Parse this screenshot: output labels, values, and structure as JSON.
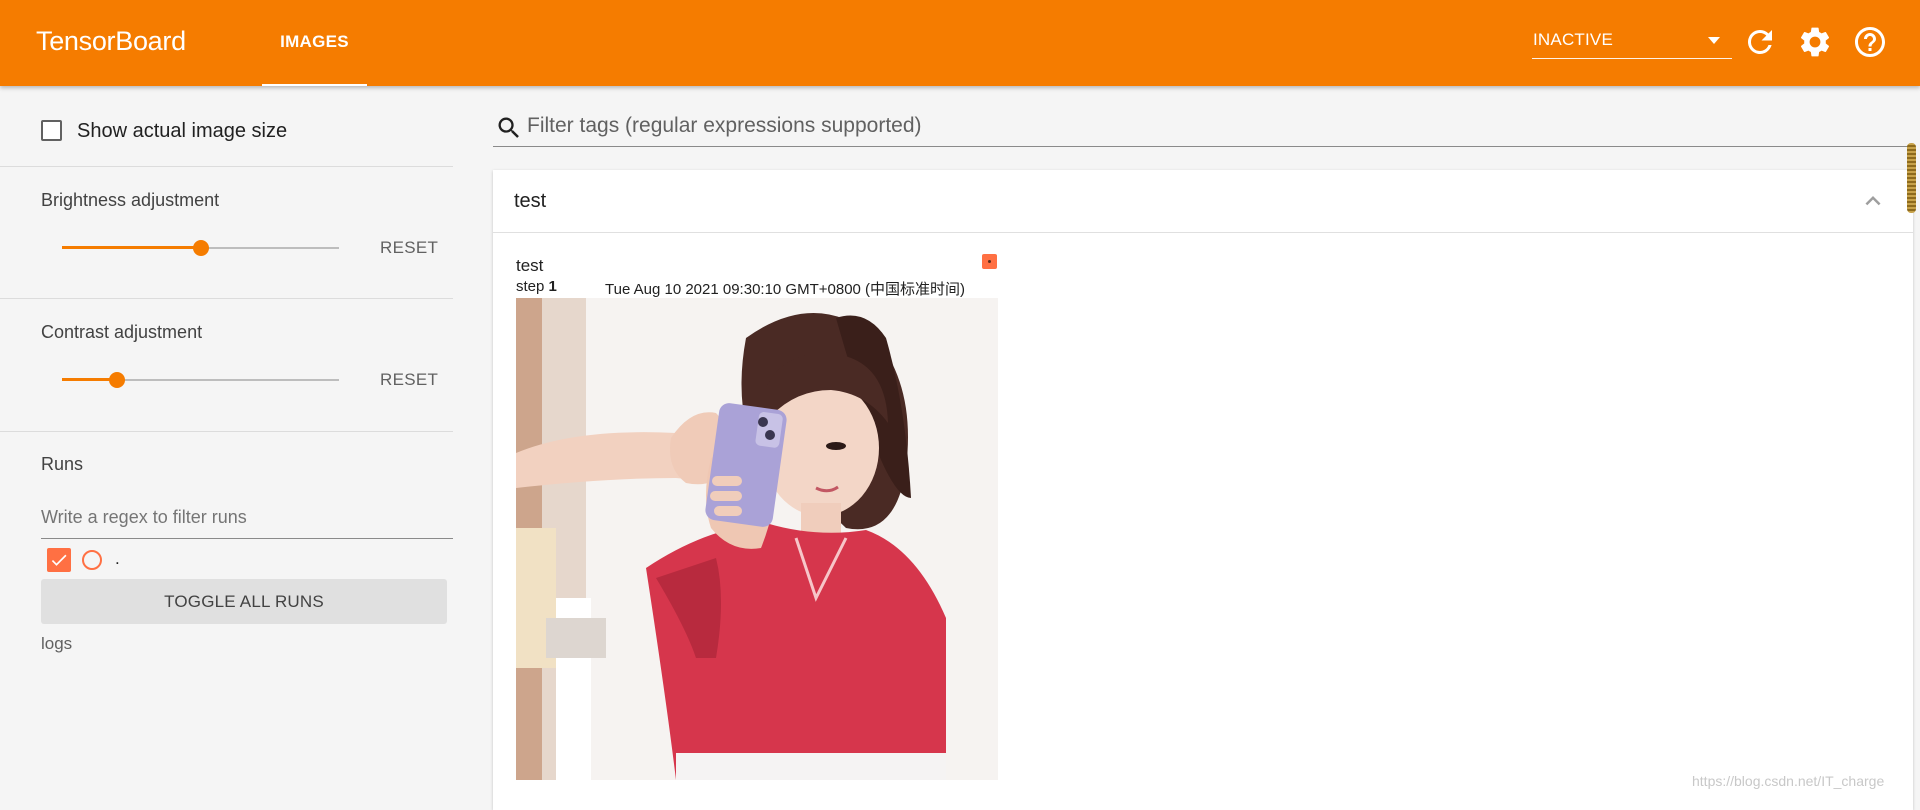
{
  "header": {
    "brand": "TensorBoard",
    "active_tab": "IMAGES",
    "run_selector_value": "INACTIVE",
    "icons": [
      "refresh-icon",
      "settings-gear-icon",
      "help-icon"
    ],
    "background_color": "#f57c00"
  },
  "sidebar": {
    "show_actual_size_label": "Show actual image size",
    "show_actual_size_checked": false,
    "brightness": {
      "title": "Brightness adjustment",
      "reset_label": "RESET",
      "level_fraction": 0.5
    },
    "contrast": {
      "title": "Contrast adjustment",
      "reset_label": "RESET",
      "level_fraction": 0.2
    },
    "runs": {
      "title": "Runs",
      "filter_placeholder": "Write a regex to filter runs",
      "items": [
        {
          "name": ".",
          "checked": true,
          "color": "#ff7043"
        }
      ],
      "toggle_all_label": "TOGGLE ALL RUNS",
      "logdir": "logs"
    }
  },
  "main": {
    "tag_filter_placeholder": "Filter tags (regular expressions supported)",
    "card": {
      "title": "test",
      "image": {
        "tag": "test",
        "step_label": "step",
        "step_value": "1",
        "timestamp": "Tue Aug 10 2021 09:30:10 GMT+0800 (中国标准时间)"
      }
    }
  },
  "watermark": "https://blog.csdn.net/IT_charge"
}
